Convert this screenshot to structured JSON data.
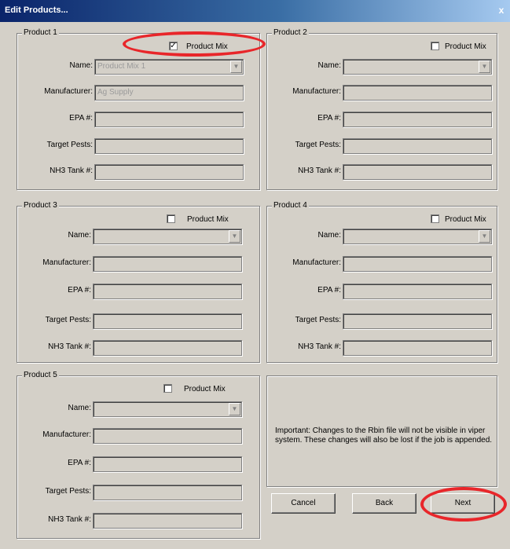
{
  "window": {
    "title": "Edit Products...",
    "close_label": "x"
  },
  "groups": [
    {
      "title": "Product 1",
      "product_mix_label": "Product Mix",
      "product_mix_checked": true,
      "check_mark": "✓",
      "name_label": "Name:",
      "name_value": "Product Mix 1",
      "manufacturer_label": "Manufacturer:",
      "manufacturer_value": "Ag Supply",
      "epa_label": "EPA #:",
      "epa_value": "",
      "target_pests_label": "Target Pests:",
      "target_pests_value": "",
      "nh3_label": "NH3 Tank #:",
      "nh3_value": ""
    },
    {
      "title": "Product 2",
      "product_mix_label": "Product Mix",
      "product_mix_checked": false,
      "check_mark": "",
      "name_label": "Name:",
      "name_value": "",
      "manufacturer_label": "Manufacturer:",
      "manufacturer_value": "",
      "epa_label": "EPA #:",
      "epa_value": "",
      "target_pests_label": "Target Pests:",
      "target_pests_value": "",
      "nh3_label": "NH3 Tank #:",
      "nh3_value": ""
    },
    {
      "title": "Product 3",
      "product_mix_label": "Product Mix",
      "product_mix_checked": false,
      "check_mark": "",
      "name_label": "Name:",
      "name_value": "",
      "manufacturer_label": "Manufacturer:",
      "manufacturer_value": "",
      "epa_label": "EPA #:",
      "epa_value": "",
      "target_pests_label": "Target Pests:",
      "target_pests_value": "",
      "nh3_label": "NH3 Tank #:",
      "nh3_value": ""
    },
    {
      "title": "Product 4",
      "product_mix_label": "Product Mix",
      "product_mix_checked": false,
      "check_mark": "",
      "name_label": "Name:",
      "name_value": "",
      "manufacturer_label": "Manufacturer:",
      "manufacturer_value": "",
      "epa_label": "EPA #:",
      "epa_value": "",
      "target_pests_label": "Target Pests:",
      "target_pests_value": "",
      "nh3_label": "NH3 Tank #:",
      "nh3_value": ""
    },
    {
      "title": "Product 5",
      "product_mix_label": "Product Mix",
      "product_mix_checked": false,
      "check_mark": "",
      "name_label": "Name:",
      "name_value": "",
      "manufacturer_label": "Manufacturer:",
      "manufacturer_value": "",
      "epa_label": "EPA #:",
      "epa_value": "",
      "target_pests_label": "Target Pests:",
      "target_pests_value": "",
      "nh3_label": "NH3 Tank #:",
      "nh3_value": ""
    }
  ],
  "note": {
    "text": "Important:  Changes to the Rbin file will not be visible in viper system.  These changes will also be lost if the job is appended."
  },
  "buttons": {
    "cancel": "Cancel",
    "back": "Back",
    "next": "Next"
  },
  "dropdown_arrow": "▼",
  "highlight_color": "#e8262a"
}
